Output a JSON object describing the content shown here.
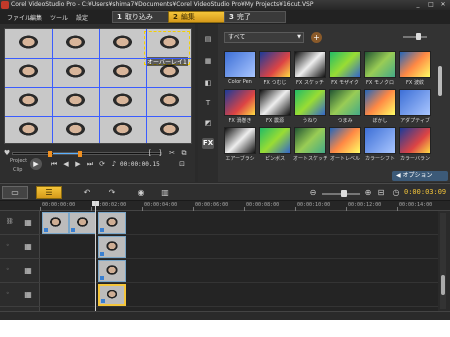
{
  "window": {
    "title": "Corel VideoStudio Pro - C:¥Users¥shima7¥Documents¥Corel VideoStudio Pro¥My Projects¥16cut.VSP",
    "minimize": "_",
    "maximize": "□",
    "close": "✕"
  },
  "menu": [
    "ファイル",
    "編集",
    "ツール",
    "設定"
  ],
  "steps": [
    {
      "num": "1",
      "label": "取り込み"
    },
    {
      "num": "2",
      "label": "編集"
    },
    {
      "num": "3",
      "label": "完了"
    }
  ],
  "preview": {
    "overlay_text": "オーバーレイ1",
    "mode_project": "Project",
    "mode_clip": "Clip",
    "timecode": "00:00:00.15"
  },
  "library": {
    "category": "すべて",
    "filters": [
      "Color Pen",
      "FX つむじ",
      "FX スケッチ",
      "FX モザイク",
      "FX モノクロ",
      "FX 波紋",
      "FX 渦巻き",
      "FX 震源",
      "うねり",
      "つまみ",
      "ぼかし",
      "アダプティブ",
      "エアーブラシ",
      "ピンボス",
      "オートスケッチ",
      "オートレベル",
      "カラーシフト",
      "カラーバラン"
    ],
    "options_label": "オプション"
  },
  "toolbar": {
    "timecode": "0:00:03:09"
  },
  "ruler": [
    "00:00:00:00",
    "00:00:02:00",
    "00:00:04:00",
    "00:00:06:00",
    "00:00:08:00",
    "00:00:10:00",
    "00:00:12:00",
    "00:00:14:00"
  ],
  "colors": {
    "accent": "#f4c53a",
    "grid": "#3a5cff",
    "clip_border": "#7aa6c8"
  }
}
